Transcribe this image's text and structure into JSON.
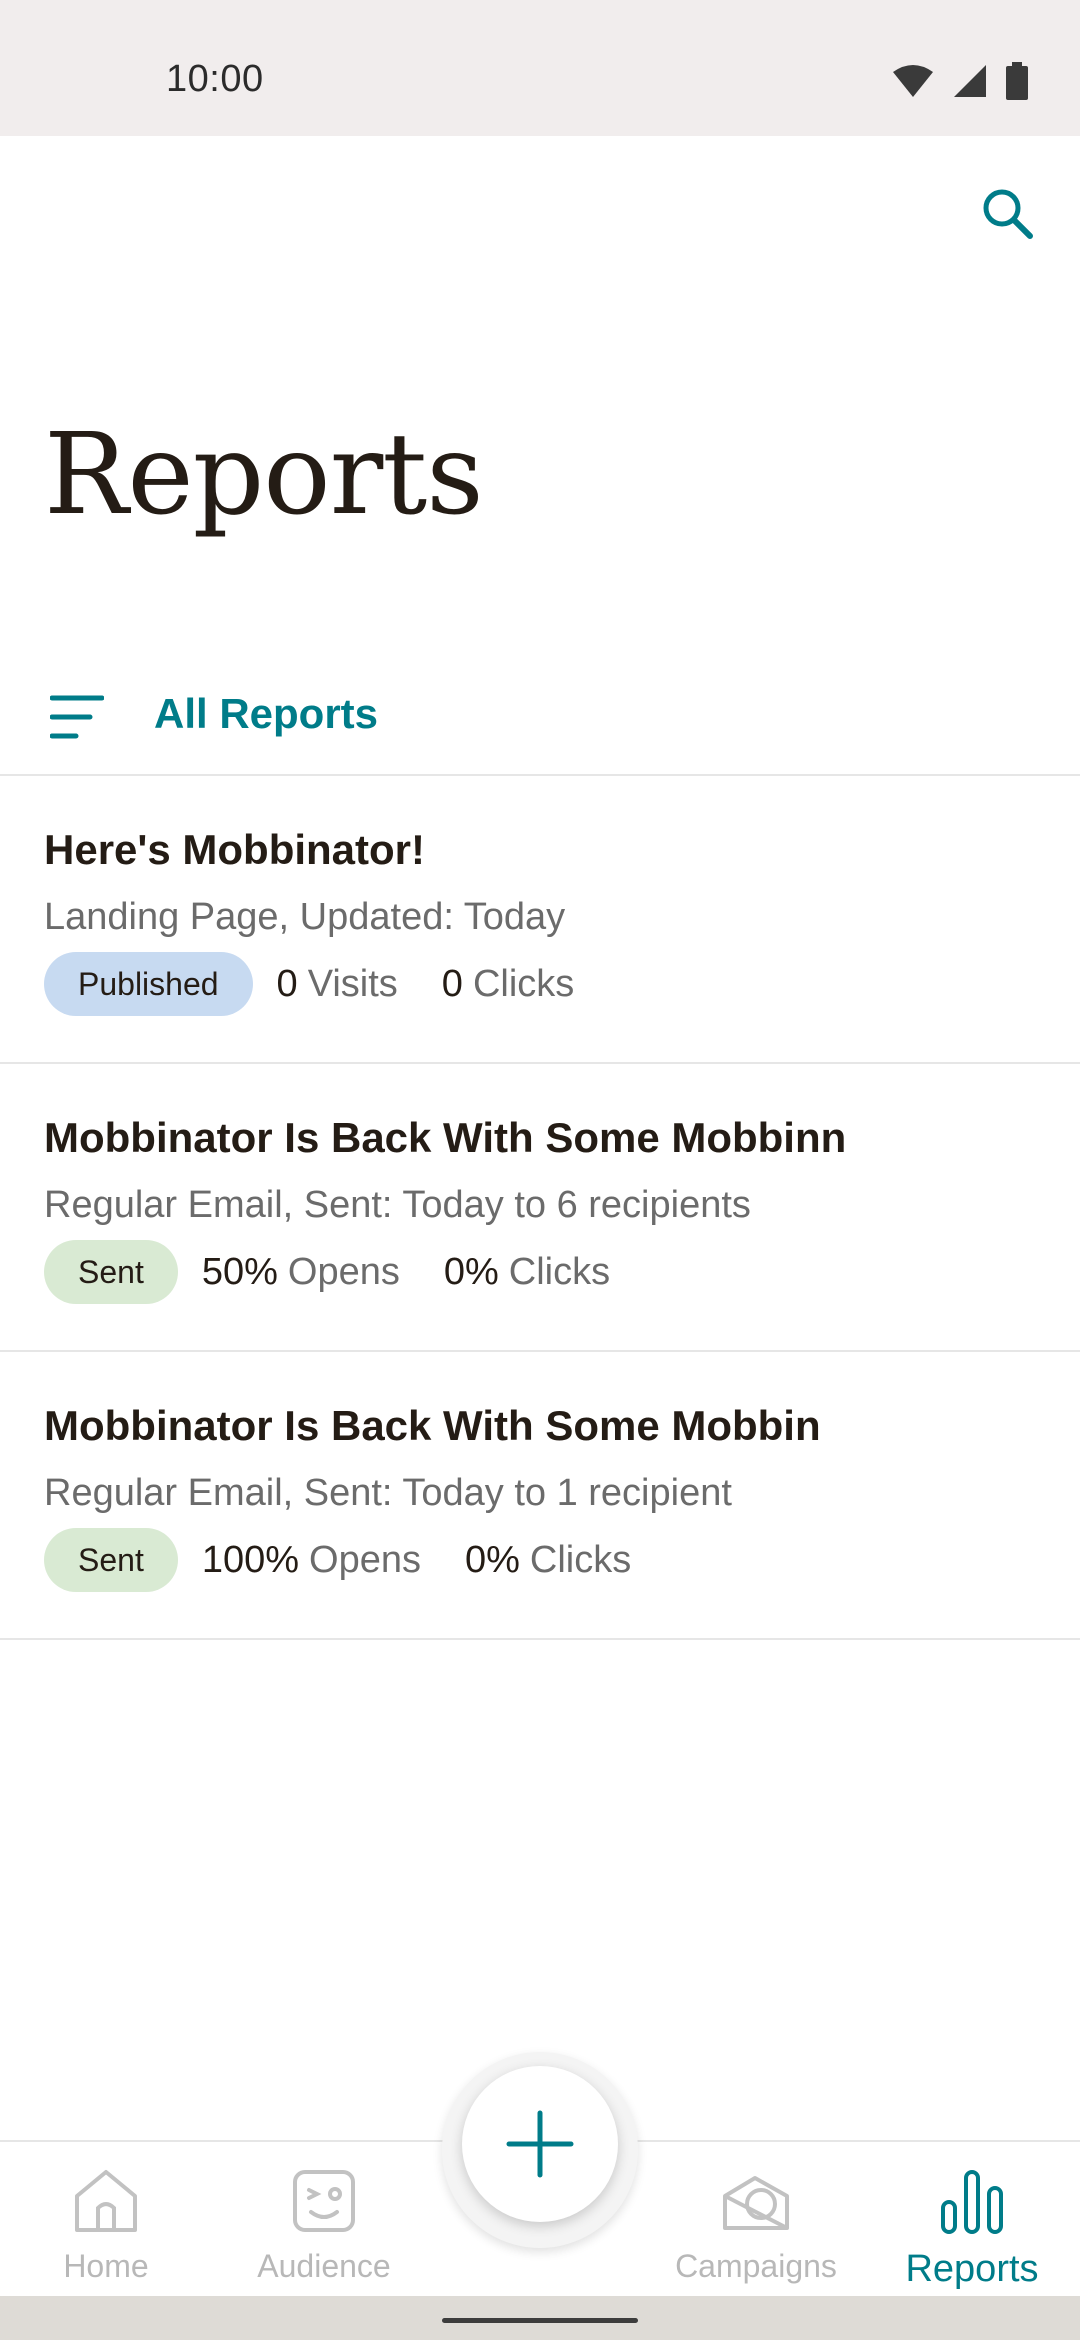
{
  "status_bar": {
    "time": "10:00",
    "icons": [
      "wifi-icon",
      "signal-icon",
      "battery-icon"
    ]
  },
  "header": {
    "title": "Reports",
    "search_icon": "search-icon"
  },
  "filter": {
    "label": "All Reports",
    "icon": "filter-icon"
  },
  "reports": [
    {
      "title": "Here's Mobbinator!",
      "subtitle": "Landing Page, Updated: Today",
      "badge": "Published",
      "stat1_value": "0",
      "stat1_label": "Visits",
      "stat2_value": "0",
      "stat2_label": "Clicks"
    },
    {
      "title": "Mobbinator Is Back With Some Mobbinn",
      "subtitle": "Regular Email, Sent: Today to 6 recipients",
      "badge": "Sent",
      "stat1_value": "50%",
      "stat1_label": "Opens",
      "stat2_value": "0%",
      "stat2_label": "Clicks"
    },
    {
      "title": "Mobbinator Is Back With Some Mobbin",
      "subtitle": "Regular Email, Sent: Today to 1 recipient",
      "badge": "Sent",
      "stat1_value": "100%",
      "stat1_label": "Opens",
      "stat2_value": "0%",
      "stat2_label": "Clicks"
    }
  ],
  "bottom_nav": {
    "items": [
      {
        "label": "Home",
        "icon": "home-icon"
      },
      {
        "label": "Audience",
        "icon": "audience-icon"
      },
      {
        "label": "Campaigns",
        "icon": "campaigns-icon"
      },
      {
        "label": "Reports",
        "icon": "reports-icon",
        "active": true
      }
    ],
    "fab_icon": "plus-icon"
  },
  "colors": {
    "accent": "#007c89",
    "published_badge": "#c7daf1",
    "sent_badge": "#d9ead3",
    "inactive_nav": "#b8b8b8"
  }
}
